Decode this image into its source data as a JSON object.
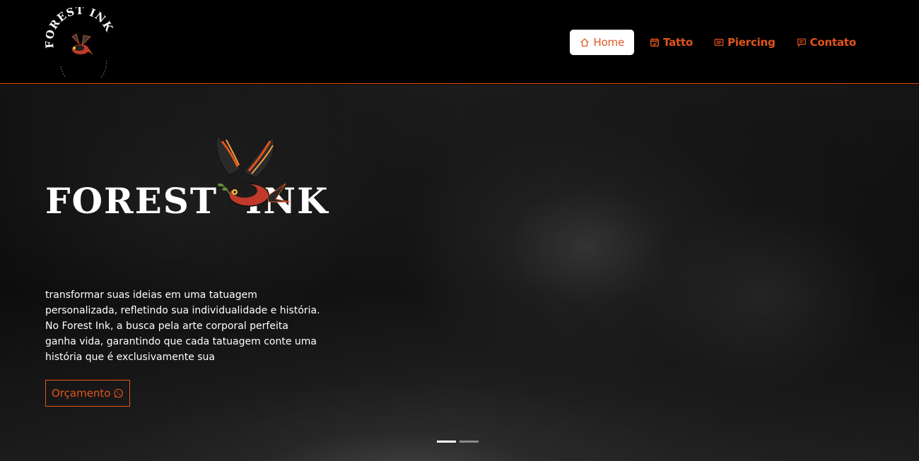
{
  "header": {
    "logo": {
      "text": "FOREST INK",
      "alt_icon": "swallow-bird"
    },
    "nav": [
      {
        "label": "Home",
        "icon": "home-icon",
        "active": true
      },
      {
        "label": "Tatto",
        "icon": "calendar-check-icon",
        "active": false
      },
      {
        "label": "Piercing",
        "icon": "list-icon",
        "active": false
      },
      {
        "label": "Contato",
        "icon": "chat-icon",
        "active": false
      }
    ]
  },
  "hero": {
    "word_left": "FOREST",
    "word_right": "INK",
    "description": "transformar suas ideias em uma tatuagem personalizada, refletindo sua individualidade e história. No Forest Ink, a busca pela arte corporal perfeita ganha vida, garantindo que cada tatuagem conte uma história que é exclusivamente sua",
    "cta_label": "Orçamento",
    "cta_icon": "whatsapp-icon",
    "slides_count": 2,
    "active_slide": 1
  },
  "colors": {
    "accent": "#e2541c",
    "background": "#000000",
    "text": "#ffffff"
  }
}
